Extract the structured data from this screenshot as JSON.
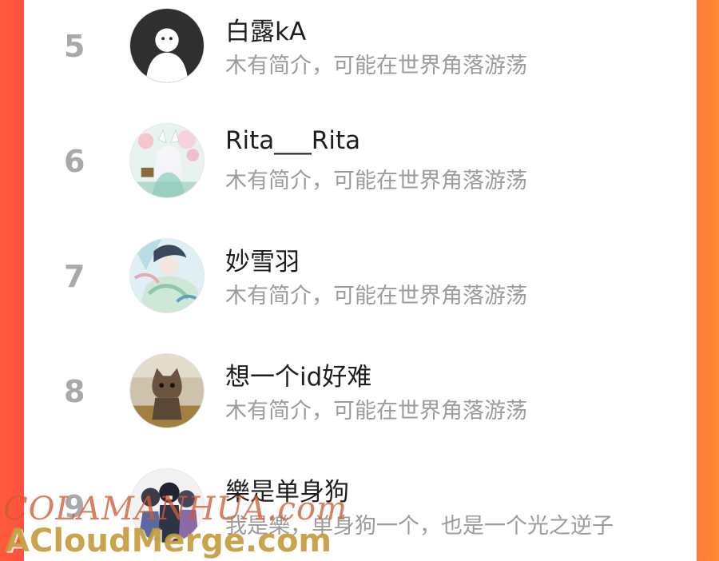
{
  "ranking": {
    "entries": [
      {
        "rank": "5",
        "name": "白露kA",
        "bio": "木有简介，可能在世界角落游荡",
        "avatar_icon": "default-user-avatar-icon"
      },
      {
        "rank": "6",
        "name": "Rita___Rita",
        "bio": "木有简介，可能在世界角落游荡",
        "avatar_icon": "anime-girl-avatar-icon"
      },
      {
        "rank": "7",
        "name": "妙雪羽",
        "bio": "木有简介，可能在世界角落游荡",
        "avatar_icon": "anime-character-avatar-icon"
      },
      {
        "rank": "8",
        "name": "想一个id好难",
        "bio": "木有简介，可能在世界角落游荡",
        "avatar_icon": "cat-photo-avatar-icon"
      },
      {
        "rank": "9",
        "name": "樂是单身狗",
        "bio": "我是樂，单身狗一个，也是一个光之逆子",
        "avatar_icon": "anime-group-avatar-icon"
      }
    ]
  },
  "watermark": {
    "line1": "COLAMANHUA.com",
    "line2": "ACloudMerge.com"
  },
  "colors": {
    "left_border": "#ff5040",
    "right_border": "#ff8a34",
    "rank_text": "#a9a9a9",
    "name_text": "#1e1e1e",
    "bio_text": "#9c9c9c"
  }
}
